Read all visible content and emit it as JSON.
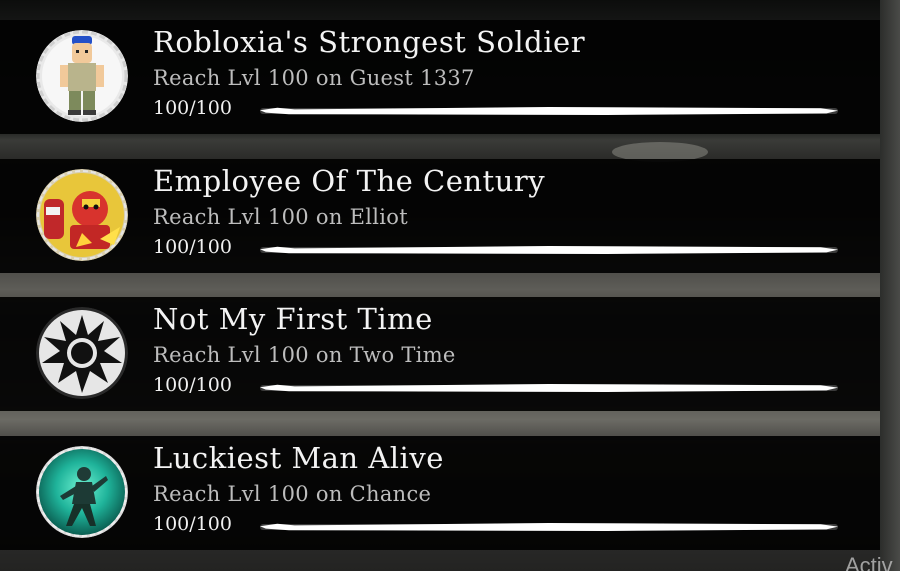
{
  "achievements": [
    {
      "title": "Robloxia's Strongest Soldier",
      "description": "Reach Lvl 100 on Guest 1337",
      "progress_text": "100/100",
      "progress_fraction": 1.0,
      "icon": "guest-1337-portrait-icon"
    },
    {
      "title": "Employee Of The Century",
      "description": "Reach Lvl 100 on Elliot",
      "progress_text": "100/100",
      "progress_fraction": 1.0,
      "icon": "elliot-portrait-icon"
    },
    {
      "title": "Not My First Time",
      "description": "Reach Lvl 100 on Two Time",
      "progress_text": "100/100",
      "progress_fraction": 1.0,
      "icon": "spiked-sun-icon"
    },
    {
      "title": "Luckiest Man Alive",
      "description": "Reach Lvl 100 on Chance",
      "progress_text": "100/100",
      "progress_fraction": 1.0,
      "icon": "chance-portrait-icon"
    }
  ],
  "watermark": "Activ",
  "colors": {
    "panel": "#020202",
    "title": "#f3f3f3",
    "description": "#bdbdbd",
    "progress_fill": "#ffffff"
  }
}
